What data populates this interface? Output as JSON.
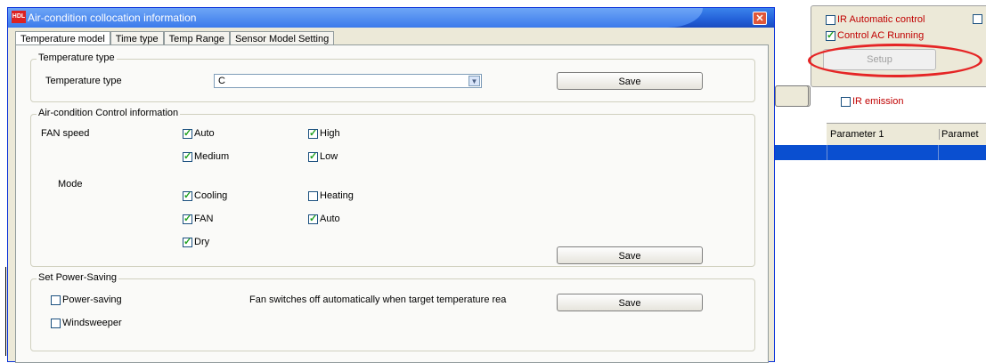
{
  "dialog": {
    "title": "Air-condition collocation information",
    "icon_text": "HDL",
    "close_symbol": "✕",
    "tabs": [
      "Temperature model",
      "Time type",
      "Temp Range",
      "Sensor Model Setting"
    ]
  },
  "temperature_type": {
    "group_title": "Temperature type",
    "label": "Temperature type",
    "selected": "C",
    "save_label": "Save"
  },
  "ac_control": {
    "group_title": "Air-condition Control information",
    "fan_speed_label": "FAN speed",
    "fan_options": [
      {
        "label": "Auto",
        "checked": true
      },
      {
        "label": "High",
        "checked": true
      },
      {
        "label": "Medium",
        "checked": true
      },
      {
        "label": "Low",
        "checked": true
      }
    ],
    "mode_label": "Mode",
    "mode_options": [
      {
        "label": "Cooling",
        "checked": true
      },
      {
        "label": "Heating",
        "checked": false
      },
      {
        "label": "FAN",
        "checked": true
      },
      {
        "label": "Auto",
        "checked": true
      },
      {
        "label": "Dry",
        "checked": true
      }
    ],
    "save_label": "Save"
  },
  "power_saving": {
    "group_title": "Set Power-Saving",
    "power_saving_label": "Power-saving",
    "power_saving_checked": false,
    "windsweeper_label": "Windsweeper",
    "windsweeper_checked": false,
    "note": "Fan switches off automatically when target temperature rea",
    "save_label": "Save"
  },
  "background_window": {
    "ir_auto_label": "IR Automatic control",
    "ir_auto_checked": false,
    "control_ac_label": "Control AC Running",
    "control_ac_checked": true,
    "setup_label": "Setup",
    "ir_emission_label": "IR emission",
    "ir_emission_checked": false,
    "columns": [
      "Parameter 1",
      "Paramet"
    ]
  },
  "colors": {
    "title_blue": "#2360d8",
    "highlight_row": "#0a4fd0",
    "annotation_red": "#e52525"
  }
}
